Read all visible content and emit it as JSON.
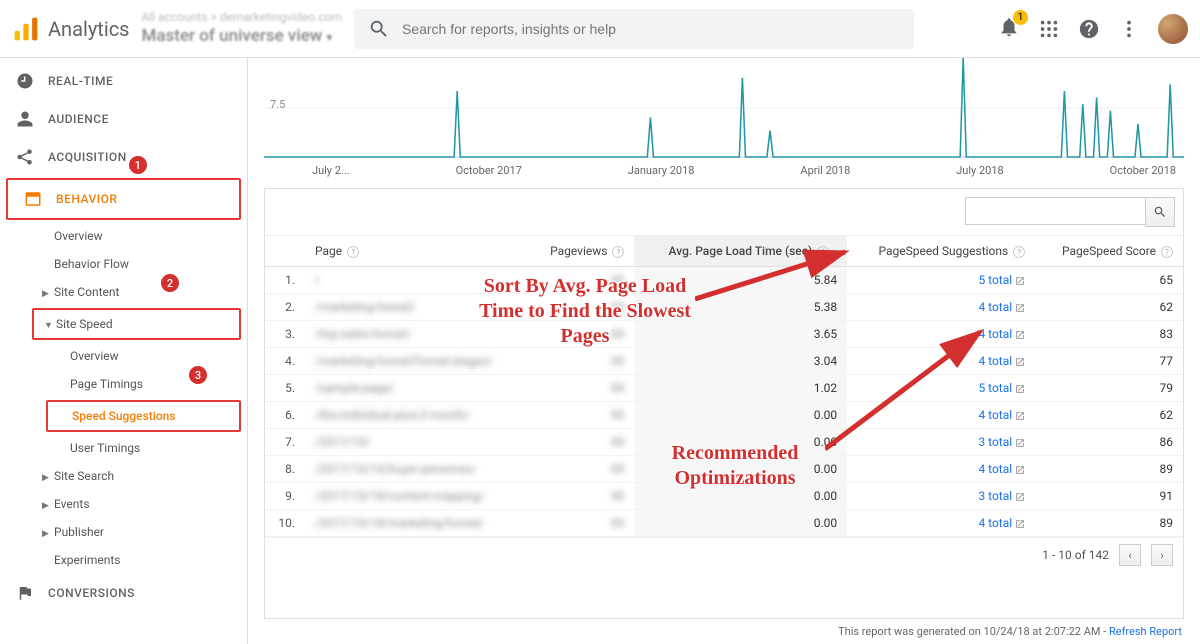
{
  "header": {
    "product": "Analytics",
    "account_line": "All accounts > demarketingvideo.com",
    "view_line": "Master of universe view",
    "search_placeholder": "Search for reports, insights or help",
    "bell_count": "1"
  },
  "sidebar": {
    "realtime": "REAL-TIME",
    "audience": "AUDIENCE",
    "acquisition": "ACQUISITION",
    "behavior": "BEHAVIOR",
    "behavior_sub": {
      "overview": "Overview",
      "behavior_flow": "Behavior Flow",
      "site_content": "Site Content",
      "site_speed": "Site Speed",
      "ss_overview": "Overview",
      "page_timings": "Page Timings",
      "speed_suggestions": "Speed Suggestions",
      "user_timings": "User Timings",
      "site_search": "Site Search",
      "events": "Events",
      "publisher": "Publisher",
      "experiments": "Experiments"
    },
    "conversions": "CONVERSIONS",
    "step1": "1",
    "step2": "2",
    "step3": "3"
  },
  "chart_data": {
    "type": "line",
    "ylabel_tick": "7.5",
    "ylim": [
      0,
      15
    ],
    "x_ticks": [
      "July 2...",
      "October 2017",
      "January 2018",
      "April 2018",
      "July 2018",
      "October 2018"
    ],
    "spikes": [
      {
        "x_frac": 0.21,
        "value": 10
      },
      {
        "x_frac": 0.42,
        "value": 6
      },
      {
        "x_frac": 0.52,
        "value": 12
      },
      {
        "x_frac": 0.55,
        "value": 4
      },
      {
        "x_frac": 0.76,
        "value": 15
      },
      {
        "x_frac": 0.87,
        "value": 10
      },
      {
        "x_frac": 0.89,
        "value": 8
      },
      {
        "x_frac": 0.905,
        "value": 9
      },
      {
        "x_frac": 0.92,
        "value": 7
      },
      {
        "x_frac": 0.95,
        "value": 5
      },
      {
        "x_frac": 0.985,
        "value": 11
      }
    ]
  },
  "table": {
    "columns": {
      "page": "Page",
      "pageviews": "Pageviews",
      "avg_load": "Avg. Page Load Time (sec)",
      "suggestions": "PageSpeed Suggestions",
      "score": "PageSpeed Score"
    },
    "rows": [
      {
        "idx": "1.",
        "page": "/",
        "avg": "5.84",
        "sugg": "5 total",
        "score": "65"
      },
      {
        "idx": "2.",
        "page": "/marketing-funnel/",
        "avg": "5.38",
        "sugg": "4 total",
        "score": "62"
      },
      {
        "idx": "3.",
        "page": "/top-sales-funnel/",
        "avg": "3.65",
        "sugg": "4 total",
        "score": "83"
      },
      {
        "idx": "4.",
        "page": "/marketing-funnel/funnel-stages/",
        "avg": "3.04",
        "sugg": "4 total",
        "score": "77"
      },
      {
        "idx": "5.",
        "page": "/sample-page/",
        "avg": "1.02",
        "sugg": "5 total",
        "score": "79"
      },
      {
        "idx": "6.",
        "page": "/the-individual-plus-2-month/",
        "avg": "0.00",
        "sugg": "4 total",
        "score": "62"
      },
      {
        "idx": "7.",
        "page": "/2017/10/",
        "avg": "0.00",
        "sugg": "3 total",
        "score": "86"
      },
      {
        "idx": "8.",
        "page": "/2017/10/10/buyer-personas/",
        "avg": "0.00",
        "sugg": "4 total",
        "score": "89"
      },
      {
        "idx": "9.",
        "page": "/2017/10/18/content-mapping/",
        "avg": "0.00",
        "sugg": "3 total",
        "score": "91"
      },
      {
        "idx": "10.",
        "page": "/2017/10/18/marketing-funnel/",
        "avg": "0.00",
        "sugg": "4 total",
        "score": "89"
      }
    ],
    "pager": "1 - 10 of 142"
  },
  "footer": {
    "generated": "This report was generated on 10/24/18 at 2:07:22 AM",
    "refresh": "Refresh Report"
  },
  "annotations": {
    "sort_hint": "Sort By Avg. Page\nLoad Time to Find\nthe Slowest Pages",
    "rec_hint": "Recommended\nOptimizations"
  }
}
